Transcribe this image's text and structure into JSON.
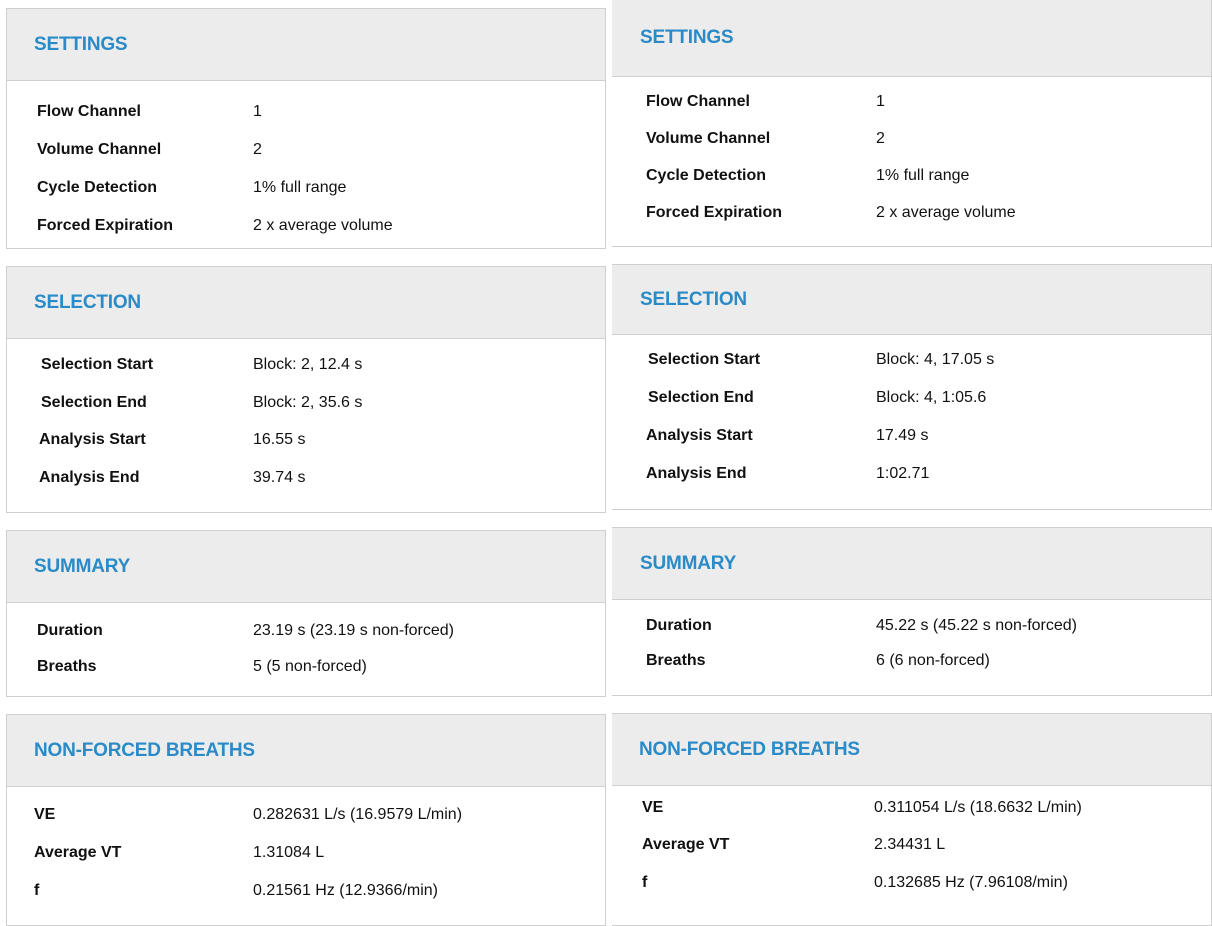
{
  "colors": {
    "header_bg": "#ececec",
    "title_blue": "#2a8bc8",
    "border": "#cfcfcf",
    "text": "#111111"
  },
  "left": {
    "settings": {
      "title": "SETTINGS",
      "rows": [
        {
          "label": "Flow Channel",
          "value": "1"
        },
        {
          "label": "Volume Channel",
          "value": "2"
        },
        {
          "label": "Cycle Detection",
          "value": "1% full range"
        },
        {
          "label": "Forced Expiration",
          "value": "2 x average volume"
        }
      ]
    },
    "selection": {
      "title": "SELECTION",
      "rows": [
        {
          "label": "Selection Start",
          "value": "Block: 2, 12.4 s"
        },
        {
          "label": "Selection End",
          "value": "Block: 2, 35.6 s"
        },
        {
          "label": "Analysis Start",
          "value": "16.55 s"
        },
        {
          "label": "Analysis End",
          "value": "39.74 s"
        }
      ]
    },
    "summary": {
      "title": "SUMMARY",
      "rows": [
        {
          "label": "Duration",
          "value": "23.19 s (23.19 s non-forced)"
        },
        {
          "label": "Breaths",
          "value": "5 (5 non-forced)"
        }
      ]
    },
    "nonforced": {
      "title": "NON-FORCED BREATHS",
      "rows": [
        {
          "label": "VE",
          "value": "0.282631 L/s (16.9579 L/min)"
        },
        {
          "label": "Average VT",
          "value": "1.31084 L"
        },
        {
          "label": "f",
          "value": "0.21561 Hz (12.9366/min)"
        }
      ]
    }
  },
  "right": {
    "settings": {
      "title": "SETTINGS",
      "rows": [
        {
          "label": "Flow Channel",
          "value": "1"
        },
        {
          "label": "Volume Channel",
          "value": "2"
        },
        {
          "label": "Cycle Detection",
          "value": "1% full range"
        },
        {
          "label": "Forced Expiration",
          "value": "2 x average volume"
        }
      ]
    },
    "selection": {
      "title": "SELECTION",
      "rows": [
        {
          "label": "Selection Start",
          "value": "Block: 4, 17.05 s"
        },
        {
          "label": "Selection End",
          "value": "Block: 4, 1:05.6"
        },
        {
          "label": "Analysis Start",
          "value": "17.49 s"
        },
        {
          "label": "Analysis End",
          "value": "1:02.71"
        }
      ]
    },
    "summary": {
      "title": "SUMMARY",
      "rows": [
        {
          "label": "Duration",
          "value": "45.22 s (45.22 s non-forced)"
        },
        {
          "label": "Breaths",
          "value": "6 (6 non-forced)"
        }
      ]
    },
    "nonforced": {
      "title": "NON-FORCED BREATHS",
      "rows": [
        {
          "label": "VE",
          "value": "0.311054 L/s (18.6632 L/min)"
        },
        {
          "label": "Average VT",
          "value": "2.34431 L"
        },
        {
          "label": "f",
          "value": "0.132685 Hz (7.96108/min)"
        }
      ]
    }
  }
}
